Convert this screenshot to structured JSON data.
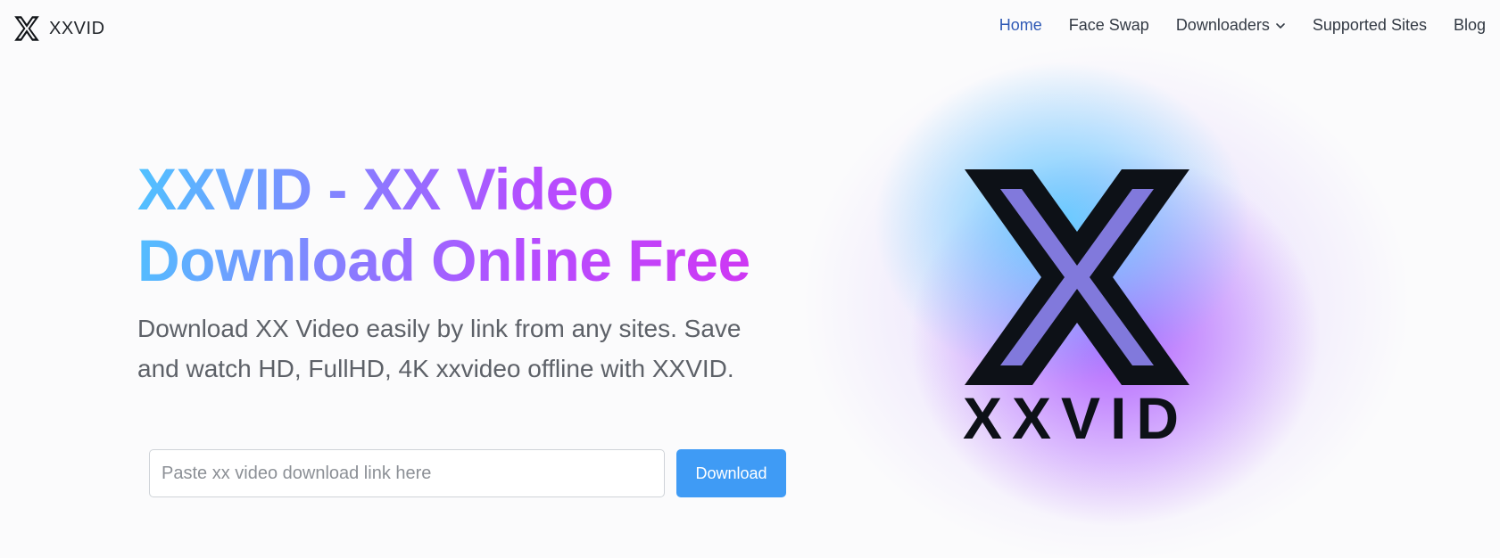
{
  "brand": {
    "name": "XXVID",
    "logo_icon": "x-logo-icon"
  },
  "nav": {
    "items": [
      {
        "label": "Home",
        "active": true
      },
      {
        "label": "Face Swap"
      },
      {
        "label": "Downloaders",
        "has_dropdown": true,
        "icon": "chevron-down-icon"
      },
      {
        "label": "Supported Sites"
      },
      {
        "label": "Blog"
      }
    ]
  },
  "hero": {
    "title_line1": "XXVID - XX Video",
    "title_line2": "Download Online Free",
    "subtitle": "Download XX Video easily by link from any sites. Save and watch HD, FullHD, 4K xxvideo offline with XXVID.",
    "input_placeholder": "Paste xx video download link here",
    "input_value": "",
    "button_label": "Download",
    "logo_text": "XXVID"
  },
  "colors": {
    "accent_blue": "#3f9bf5",
    "nav_active": "#2f59b5",
    "gradient_start": "#4fc3ff",
    "gradient_end": "#d235f2",
    "logo_dark": "#0d1117"
  }
}
